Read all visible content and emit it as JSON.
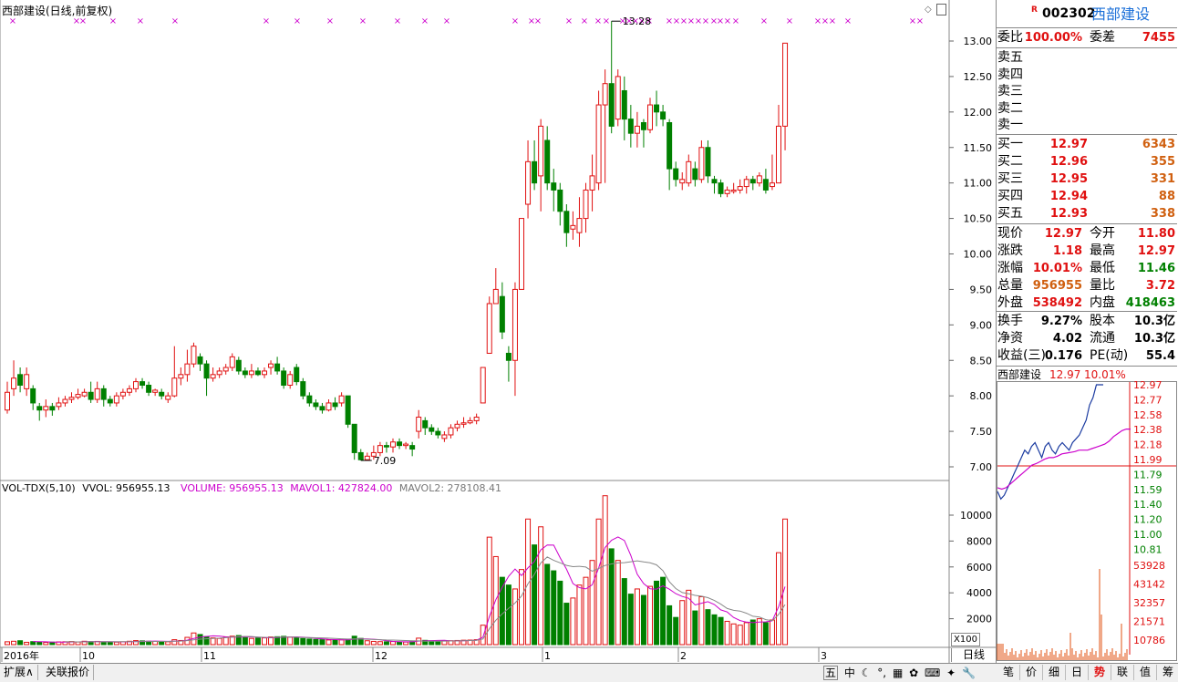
{
  "header": {
    "title": "西部建设(日线,前复权)",
    "annot_high": "13.28",
    "annot_low": "7.09"
  },
  "volume_header": {
    "label": "VOL-TDX(5,10)",
    "vvol": "VVOL: 956955.13",
    "volume": "VOLUME: 956955.13",
    "mavol1": "MAVOL1: 427824.00",
    "mavol2": "MAVOL2: 278108.41"
  },
  "price_axis": [
    "13.00",
    "12.50",
    "12.00",
    "11.50",
    "11.00",
    "10.50",
    "10.00",
    "9.50",
    "9.00",
    "8.50",
    "8.00",
    "7.50",
    "7.00"
  ],
  "vol_axis": [
    "10000",
    "8000",
    "6000",
    "4000",
    "2000"
  ],
  "vol_unit": "X100",
  "date_axis": [
    "2016年",
    "10",
    "11",
    "12",
    "1",
    "2",
    "3"
  ],
  "bottom_tabs": [
    "扩展∧",
    "关联报价"
  ],
  "period_tab": "日线",
  "toolbar_icons": [
    "五",
    "中",
    "☾",
    "°,",
    "▦",
    "✿",
    "⌨",
    "✦",
    "🔧"
  ],
  "quote": {
    "code_prefix": "R",
    "code": "002302",
    "name": "西部建设",
    "weibi_label": "委比",
    "weibi": "100.00%",
    "weicha_label": "委差",
    "weicha": "7455",
    "sell": [
      {
        "label": "卖五"
      },
      {
        "label": "卖四"
      },
      {
        "label": "卖三"
      },
      {
        "label": "卖二"
      },
      {
        "label": "卖一"
      }
    ],
    "buy": [
      {
        "label": "买一",
        "price": "12.97",
        "vol": "6343"
      },
      {
        "label": "买二",
        "price": "12.96",
        "vol": "355"
      },
      {
        "label": "买三",
        "price": "12.95",
        "vol": "331"
      },
      {
        "label": "买四",
        "price": "12.94",
        "vol": "88"
      },
      {
        "label": "买五",
        "price": "12.93",
        "vol": "338"
      }
    ],
    "stats": [
      {
        "l1": "现价",
        "v1": "12.97",
        "c1": "red",
        "l2": "今开",
        "v2": "11.80",
        "c2": "red"
      },
      {
        "l1": "涨跌",
        "v1": "1.18",
        "c1": "red",
        "l2": "最高",
        "v2": "12.97",
        "c2": "red"
      },
      {
        "l1": "涨幅",
        "v1": "10.01%",
        "c1": "red",
        "l2": "最低",
        "v2": "11.46",
        "c2": "green"
      },
      {
        "l1": "总量",
        "v1": "956955",
        "c1": "red",
        "l2": "量比",
        "v2": "3.72",
        "c2": "red"
      },
      {
        "l1": "外盘",
        "v1": "538492",
        "c1": "red",
        "l2": "内盘",
        "v2": "418463",
        "c2": "green"
      }
    ],
    "fund": [
      {
        "l1": "换手",
        "v1": "9.27%",
        "l2": "股本",
        "v2": "10.3亿"
      },
      {
        "l1": "净资",
        "v1": "4.02",
        "l2": "流通",
        "v2": "10.3亿"
      },
      {
        "l1": "收益(三)",
        "v1": "0.176",
        "l2": "PE(动)",
        "v2": "55.4"
      }
    ]
  },
  "mini": {
    "name": "西部建设",
    "price": "12.97",
    "pct": "10.01%",
    "left_axis": [
      "12.97",
      "12.77",
      "12.58",
      "12.38",
      "12.18",
      "11.99",
      "11.79",
      "11.59",
      "11.40",
      "11.20",
      "11.00",
      "10.81"
    ],
    "vol_axis": [
      "53928",
      "43142",
      "32357",
      "21571",
      "10786"
    ]
  },
  "right_tabs": [
    "笔",
    "价",
    "细",
    "日",
    "势",
    "联",
    "值",
    "筹"
  ],
  "colors": {
    "up": "#e01010",
    "down": "#008000",
    "ma1": "#cc00cc",
    "ma2": "#888888",
    "blue": "#1a3aa0",
    "accent": "#e01010"
  }
}
